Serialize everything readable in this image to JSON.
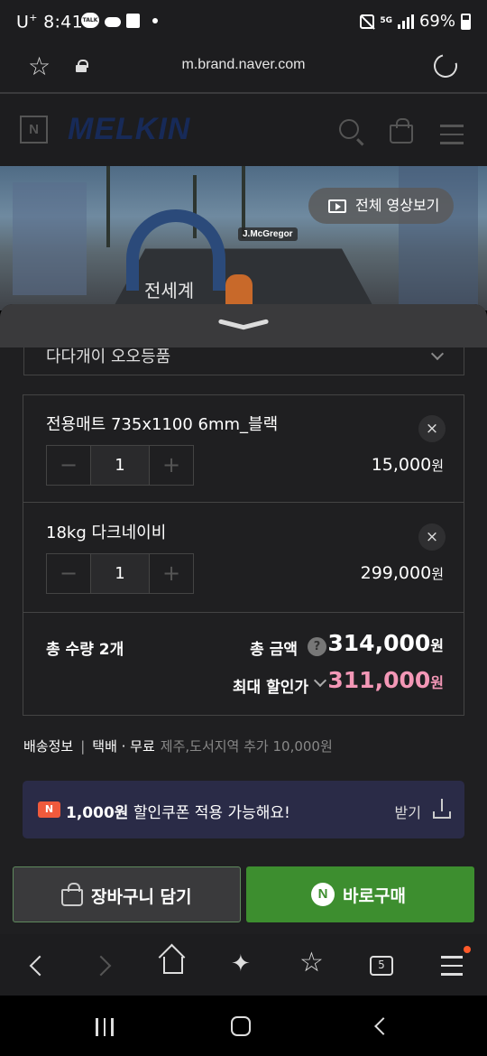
{
  "status_bar": {
    "carrier": "U",
    "carrier_plus": "+",
    "time": "8:41",
    "talk_label": "TALK",
    "network": "5G",
    "battery": "69%"
  },
  "browser": {
    "url": "m.brand.naver.com"
  },
  "site_header": {
    "brand_badge": "N",
    "logo": "MELKIN"
  },
  "video": {
    "rider_name": "J.McGregor",
    "caption": "전세계",
    "all_videos_label": "전체 영상보기"
  },
  "option_select": {
    "label": "다다개이 오오등품"
  },
  "cart_items": [
    {
      "name": "전용매트 735x1100 6mm_블랙",
      "quantity": "1",
      "price": "15,000",
      "currency": "원",
      "minus": "−",
      "plus": "+",
      "remove": "×"
    },
    {
      "name": "18kg 다크네이비",
      "quantity": "1",
      "price": "299,000",
      "currency": "원",
      "minus": "−",
      "plus": "+",
      "remove": "×"
    }
  ],
  "summary": {
    "total_qty_label": "총 수량 2개",
    "total_amount_label": "총 금액",
    "info_icon": "?",
    "total_amount": "314,000",
    "max_discount_label": "최대 할인가",
    "max_discount_price": "311,000",
    "currency": "원",
    "accent_color": "#f397b6"
  },
  "shipping": {
    "label": "배송정보",
    "separator": "|",
    "method": "택배 · 무료",
    "extra": "제주,도서지역 추가 10,000원"
  },
  "coupon": {
    "badge": "N",
    "amount": "1,000원",
    "text": "할인쿠폰 적용 가능해요!",
    "action": "받기"
  },
  "actions": {
    "cart_label": "장바구니 담기",
    "buy_badge": "N",
    "buy_label": "바로구매",
    "buy_color": "#3d8e2f"
  },
  "browser_toolbar": {
    "tab_count": "5"
  }
}
